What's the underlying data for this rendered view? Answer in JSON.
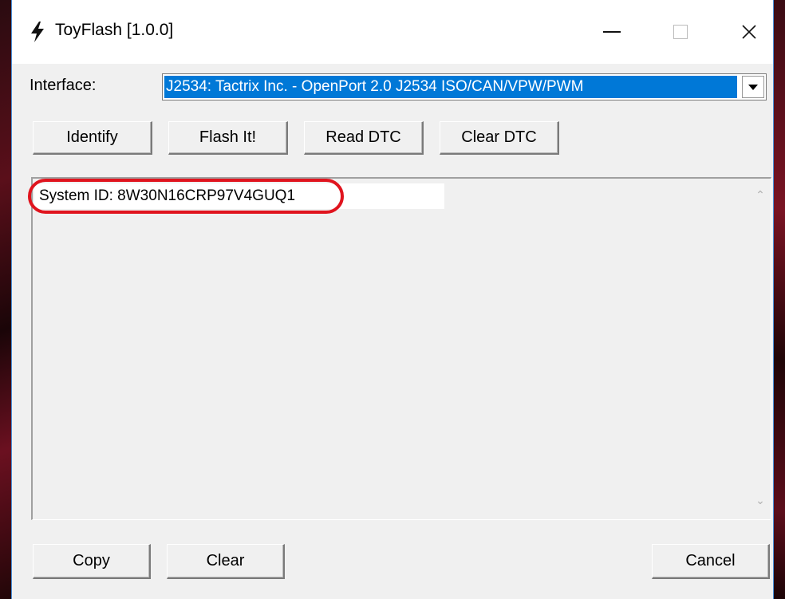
{
  "window": {
    "title": "ToyFlash [1.0.0]",
    "title_icon": "lightning-bolt-icon",
    "controls": {
      "minimize_icon": "minimize-icon",
      "maximize_icon": "maximize-icon",
      "close_icon": "close-icon",
      "close_glyph": "✕"
    }
  },
  "interface": {
    "label": "Interface:",
    "selected_value": "J2534: Tactrix Inc. - OpenPort 2.0 J2534 ISO/CAN/VPW/PWM",
    "dropdown_icon": "chevron-down-icon"
  },
  "actions": {
    "identify_label": "Identify",
    "flash_label": "Flash It!",
    "read_dtc_label": "Read DTC",
    "clear_dtc_label": "Clear DTC"
  },
  "output": {
    "lines": [
      "System ID: 8W30N16CRP97V4GUQ1"
    ],
    "highlight_color": "#e0141e",
    "scroll_up_glyph": "⌃",
    "scroll_down_glyph": "⌄"
  },
  "footer": {
    "copy_label": "Copy",
    "clear_label": "Clear",
    "cancel_label": "Cancel"
  },
  "colors": {
    "selection": "#0078d7",
    "window_bg": "#f0f0f0",
    "accent_border": "#4a90d9"
  }
}
